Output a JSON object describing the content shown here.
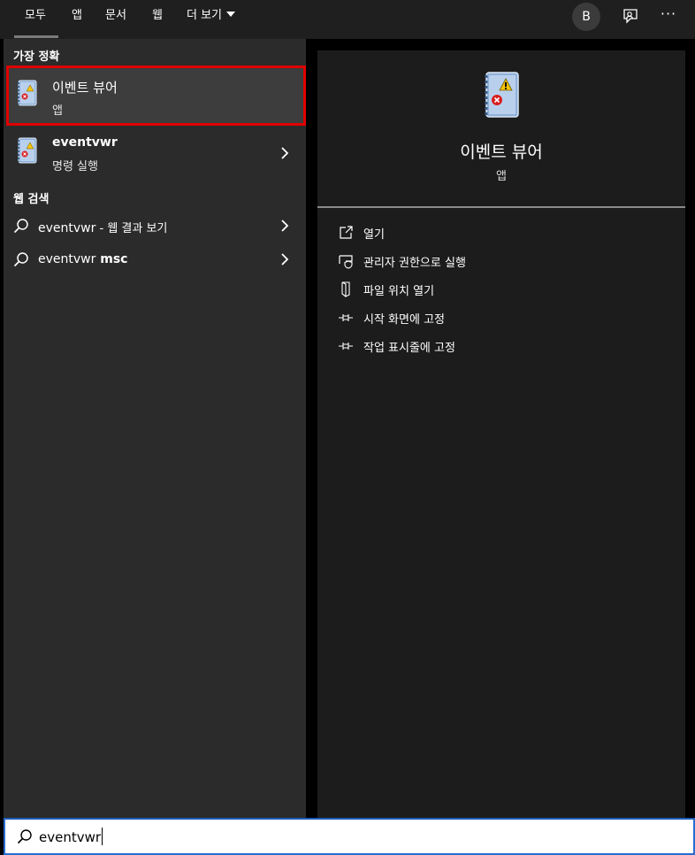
{
  "tabs": [
    {
      "label": "모두",
      "active": true
    },
    {
      "label": "앱"
    },
    {
      "label": "문서"
    },
    {
      "label": "웹"
    },
    {
      "label": "더 보기"
    }
  ],
  "header": {
    "avatar_letter": "B",
    "more_label": "···",
    "feedback_icon": "feedback-icon"
  },
  "best_match": {
    "heading": "가장 정확",
    "title": "이벤트 뷰어",
    "subtitle": "앱"
  },
  "results": [
    {
      "title": "eventvwr",
      "subtitle": "명령 실행"
    }
  ],
  "web_search": {
    "heading": "웹 검색",
    "items": [
      {
        "query": "eventvwr",
        "suffix": " - 웹 결과 보기"
      },
      {
        "query": "eventvwr",
        "bold_suffix": " msc"
      }
    ]
  },
  "detail": {
    "title": "이벤트 뷰어",
    "type": "앱",
    "actions": [
      {
        "label": "열기",
        "icon": "open-icon"
      },
      {
        "label": "관리자 권한으로 실행",
        "icon": "shield-icon"
      },
      {
        "label": "파일 위치 열기",
        "icon": "file-location-icon"
      },
      {
        "label": "시작 화면에 고정",
        "icon": "pin-icon"
      },
      {
        "label": "작업 표시줄에 고정",
        "icon": "pin-icon"
      }
    ]
  },
  "search": {
    "value": "eventvwr"
  },
  "colors": {
    "highlight_border": "#e00000",
    "left_panel": "#2b2b2b",
    "right_panel": "#1c1c1c",
    "accent_border": "#2a6ccf"
  }
}
